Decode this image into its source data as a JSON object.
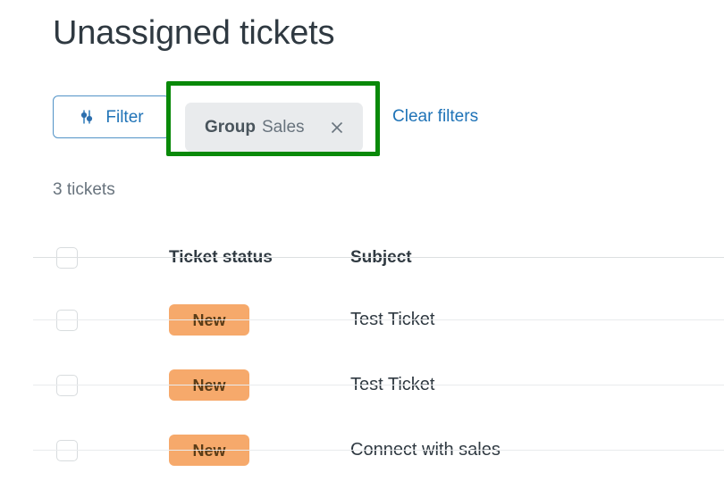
{
  "page": {
    "title": "Unassigned tickets"
  },
  "toolbar": {
    "filter_button_label": "Filter",
    "filter_icon": "sliders-icon",
    "chip": {
      "key": "Group",
      "value": "Sales",
      "close_icon": "close-icon"
    },
    "clear_filters_label": "Clear filters",
    "highlight_color": "#098909",
    "link_color": "#1f73b7"
  },
  "summary": {
    "count_label": "3 tickets"
  },
  "table": {
    "columns": [
      {
        "key": "select",
        "label": ""
      },
      {
        "key": "status",
        "label": "Ticket status"
      },
      {
        "key": "subject",
        "label": "Subject"
      }
    ],
    "rows": [
      {
        "status": "New",
        "subject": "Test Ticket"
      },
      {
        "status": "New",
        "subject": "Test Ticket"
      },
      {
        "status": "New",
        "subject": "Connect with sales"
      }
    ],
    "badge_color": "#f6a96b",
    "badge_text_color": "#5a3c17"
  }
}
